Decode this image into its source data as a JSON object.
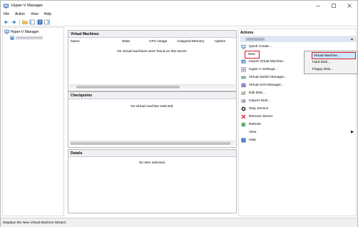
{
  "window": {
    "title": "Hyper-V Manager"
  },
  "menu": [
    "File",
    "Action",
    "View",
    "Help"
  ],
  "toolbar": {
    "icons": [
      "back-arrow-icon",
      "forward-arrow-icon",
      "folder-icon",
      "console-tree-icon",
      "help-icon",
      "properties-icon"
    ]
  },
  "tree": {
    "root_label": "Hyper-V Manager"
  },
  "virtual_machines": {
    "header": "Virtual Machines",
    "columns": [
      "Name",
      "State",
      "CPU Usage",
      "Assigned Memory",
      "Uptime"
    ],
    "empty_message": "No virtual machines were found on this server."
  },
  "checkpoints": {
    "header": "Checkpoints",
    "empty_message": "No virtual machine selected."
  },
  "details": {
    "header": "Details",
    "empty_message": "No item selected."
  },
  "actions": {
    "header": "Actions",
    "items": [
      {
        "label": "Quick Create...",
        "icon": "quick-create-icon"
      },
      {
        "label": "New",
        "icon": ""
      },
      {
        "label": "Import Virtual Machine...",
        "icon": "import-icon"
      },
      {
        "label": "Hyper-V Settings...",
        "icon": "settings-icon"
      },
      {
        "label": "Virtual Switch Manager...",
        "icon": "switch-icon"
      },
      {
        "label": "Virtual SAN Manager...",
        "icon": "san-icon"
      },
      {
        "label": "Edit Disk...",
        "icon": "edit-disk-icon"
      },
      {
        "label": "Inspect Disk...",
        "icon": "inspect-disk-icon"
      },
      {
        "label": "Stop Service",
        "icon": "stop-icon"
      },
      {
        "label": "Remove Server",
        "icon": "remove-icon"
      },
      {
        "label": "Refresh",
        "icon": "refresh-icon"
      },
      {
        "label": "View",
        "icon": ""
      },
      {
        "label": "Help",
        "icon": "help-icon"
      }
    ]
  },
  "new_flyout": [
    "Virtual Machine...",
    "Hard Disk...",
    "Floppy Disk..."
  ],
  "status_bar": {
    "text": "Displays the New Virtual Machine Wizard."
  },
  "colors": {
    "highlight_border": "#d8182a",
    "highlight_fill": "#cde8ff",
    "header_fill": "#eef0f4"
  }
}
